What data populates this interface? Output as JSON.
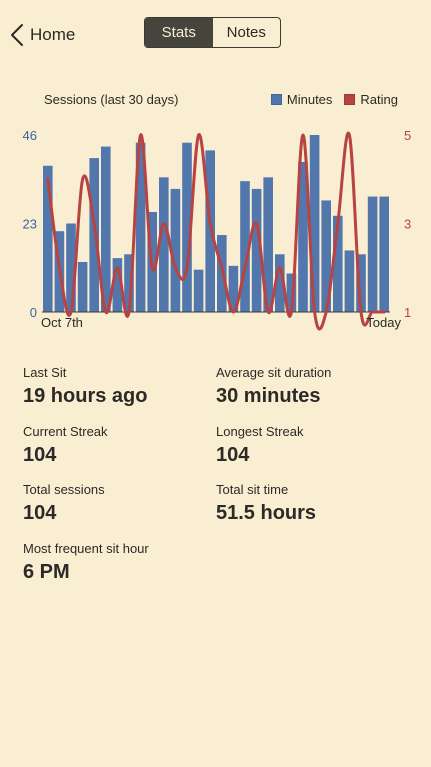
{
  "nav": {
    "back_label": "Home",
    "tabs": [
      {
        "label": "Stats",
        "active": true
      },
      {
        "label": "Notes",
        "active": false
      }
    ]
  },
  "chart": {
    "title": "Sessions (last 30 days)",
    "legend": [
      {
        "label": "Minutes",
        "color": "#5277ad"
      },
      {
        "label": "Rating",
        "color": "#b84343"
      }
    ]
  },
  "chart_data": {
    "type": "bar",
    "title": "Sessions (last 30 days)",
    "x_start_label": "Oct 7th",
    "x_end_label": "Today",
    "series": [
      {
        "name": "Minutes",
        "type": "bar",
        "axis": "left",
        "color": "#5277ad",
        "values": [
          38,
          21,
          23,
          13,
          40,
          43,
          14,
          15,
          44,
          26,
          35,
          32,
          44,
          11,
          42,
          20,
          12,
          34,
          32,
          35,
          15,
          10,
          39,
          46,
          29,
          25,
          16,
          15,
          30,
          30
        ]
      },
      {
        "name": "Rating",
        "type": "line",
        "axis": "right",
        "color": "#b84343",
        "values": [
          4,
          2,
          1,
          4,
          3,
          1,
          2,
          1,
          5,
          2,
          3,
          2,
          2,
          5,
          3,
          2,
          1,
          2,
          3,
          1,
          2,
          1,
          5,
          1,
          1,
          3,
          5,
          1,
          1,
          1
        ]
      }
    ],
    "y_left": {
      "min": 0,
      "max": 46,
      "ticks": [
        0,
        23,
        46
      ]
    },
    "y_right": {
      "min": 1,
      "max": 5,
      "ticks": [
        1,
        3,
        5
      ]
    }
  },
  "axis": {
    "left_color": "#3e63a0",
    "right_color": "#b84343"
  },
  "stats": {
    "last_sit_label": "Last Sit",
    "last_sit_value": "19 hours ago",
    "avg_duration_label": "Average sit duration",
    "avg_duration_value": "30 minutes",
    "current_streak_label": "Current Streak",
    "current_streak_value": "104",
    "longest_streak_label": "Longest Streak",
    "longest_streak_value": "104",
    "total_sessions_label": "Total sessions",
    "total_sessions_value": "104",
    "total_time_label": "Total sit time",
    "total_time_value": "51.5 hours",
    "frequent_hour_label": "Most frequent sit hour",
    "frequent_hour_value": "6 PM"
  },
  "icons": {
    "back": "chevron-left-icon"
  }
}
